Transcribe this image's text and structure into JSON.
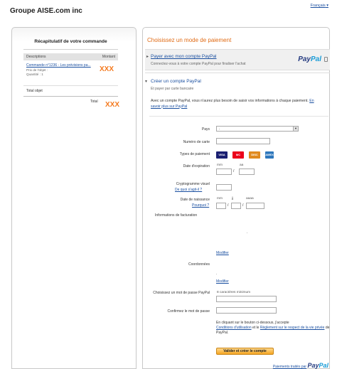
{
  "header": {
    "merchant_name": "Groupe AISE.com inc",
    "language": "Français"
  },
  "cart": {
    "title": "Récapitulatif de votre commande",
    "col_description": "Descriptions",
    "col_amount": "Montant",
    "item": {
      "link": "Commande n°1236 - Les prévisions pa...",
      "price_label": "Prix de l'objet :",
      "quantity": "Quantité : 1",
      "amount": "XXX"
    },
    "total_items_label": "Total objet",
    "total_label": "Total",
    "total_amount": "XXX"
  },
  "payment": {
    "title": "Choisissez un mode de paiement",
    "login": {
      "link": "Payer avec mon compte PayPal",
      "description": "Connectez-vous à votre compte PayPal pour finaliser l'achat",
      "logo_pay": "Pay",
      "logo_pal": "Pal"
    },
    "create": {
      "title": "Créer un compte PayPal",
      "subtitle": "Et payer par carte bancaire",
      "intro": "Avec un compte PayPal, vous n'aurez plus besoin de saisir vos informations à chaque paiement.",
      "intro_link": "En savoir plus sur PayPal",
      "country_label": "Pays",
      "country_value": ".",
      "card_number_label": "Numéro de carte",
      "card_types_label": "Types de paiement",
      "card_types": [
        "VISA",
        "MC",
        "DISC",
        "AMEX"
      ],
      "expiry_label": "Date d'expiration",
      "mm": "mm",
      "aa": "aa",
      "slash": "/",
      "cvv_label": "Cryptogramme visuel",
      "cvv_help": "De quoi s'agit-il ?",
      "dob_label": "Date de naissance",
      "dob_help": "Pourquoi ?",
      "jj": "jj",
      "aaaa": "aaaa",
      "billing_label": "Informations de facturation",
      "modify": "Modifier",
      "contact_label": "Coordonnées",
      "password_label": "Choisissez un mot de passe PayPal",
      "password_hint": "8 caractères minimum",
      "confirm_label": "Confirmez le mot de passe",
      "terms_intro": "En cliquant sur le bouton ci-dessous, j'accepte",
      "terms_link": "Conditions d'utilisation",
      "terms_and": "et le",
      "privacy_link": "Règlement sur le respect de la vie privée",
      "terms_end": "de PayPal.",
      "submit": "Valider et créer le compte"
    },
    "footer": {
      "text": "Paiements traités par",
      "logo_pay": "Pay",
      "logo_pal": "Pal"
    }
  },
  "colors": {
    "accent_orange": "#f47a1f",
    "link_blue": "#1a4fa0",
    "paypal_dark": "#253b80",
    "paypal_light": "#179bd7"
  }
}
